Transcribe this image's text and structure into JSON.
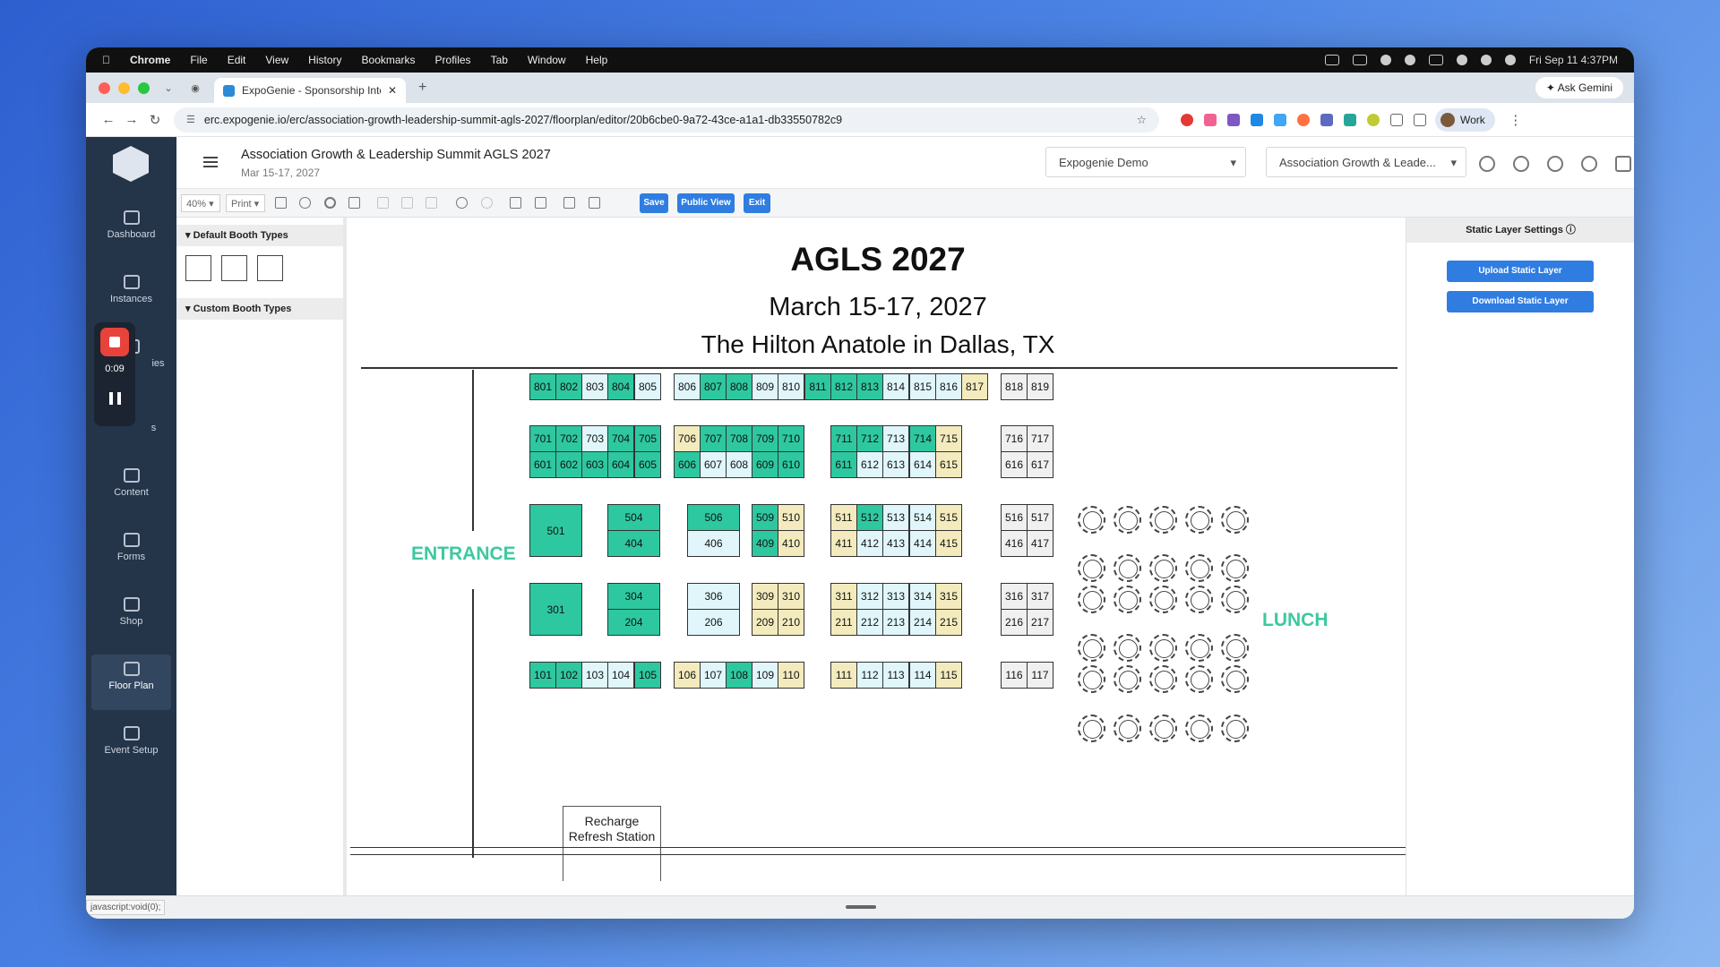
{
  "mac_menubar": {
    "app_name": "Chrome",
    "menus": [
      "File",
      "Edit",
      "View",
      "History",
      "Bookmarks",
      "Profiles",
      "Tab",
      "Window",
      "Help"
    ],
    "clock": "Fri Sep 11  4:37PM"
  },
  "browser": {
    "tab_title": "ExpoGenie - Sponsorship Inte",
    "gemini_label": "Ask Gemini",
    "url": "erc.expogenie.io/erc/association-growth-leadership-summit-agls-2027/floorplan/editor/20b6cbe0-9a72-43ce-a1a1-db33550782c9",
    "profile_label": "Work",
    "colors": {
      "close": "#ff5f57",
      "minimize": "#febc2e",
      "zoom": "#28c840"
    }
  },
  "sidebar": {
    "items": [
      {
        "label": "Dashboard",
        "icon": "home-icon"
      },
      {
        "label": "Instances",
        "icon": "building-icon"
      },
      {
        "label": "ies",
        "icon": "users-icon"
      },
      {
        "label": "s",
        "icon": "list-icon"
      },
      {
        "label": "Content",
        "icon": "content-icon"
      },
      {
        "label": "Forms",
        "icon": "forms-icon"
      },
      {
        "label": "Shop",
        "icon": "cart-icon"
      },
      {
        "label": "Floor Plan",
        "icon": "map-icon",
        "active": true
      },
      {
        "label": "Event Setup",
        "icon": "calendar-icon"
      }
    ],
    "recording_time": "0:09"
  },
  "header": {
    "event_title": "Association Growth & Leadership Summit AGLS 2027",
    "event_dates": "Mar 15-17, 2027",
    "org_select": "Expogenie Demo",
    "event_select": "Association Growth & Leade..."
  },
  "toolbar": {
    "zoom": "40%",
    "print": "Print",
    "save": "Save",
    "public_view": "Public View",
    "exit": "Exit"
  },
  "left_panel": {
    "default_types": "Default Booth Types",
    "custom_types": "Custom Booth Types"
  },
  "right_panel": {
    "title": "Static Layer Settings ⓘ",
    "upload": "Upload Static Layer",
    "download": "Download Static Layer"
  },
  "floorplan": {
    "title": "AGLS 2027",
    "dates": "March 15-17, 2027",
    "venue": "The Hilton Anatole in Dallas, TX",
    "entrance": "ENTRANCE",
    "lunch": "LUNCH",
    "recharge": "Recharge Refresh Station",
    "colors": {
      "teal": "#2ec8a0",
      "light": "#e0f6fb",
      "yellow": "#f3ebbd",
      "white": "#ffffff",
      "grey": "#f0f0f0"
    },
    "booths": [
      {
        "id": "801",
        "c": "teal"
      },
      {
        "id": "802",
        "c": "teal"
      },
      {
        "id": "803",
        "c": "light"
      },
      {
        "id": "804",
        "c": "teal"
      },
      {
        "id": "805",
        "c": "light"
      },
      {
        "id": "806",
        "c": "light"
      },
      {
        "id": "807",
        "c": "teal"
      },
      {
        "id": "808",
        "c": "teal"
      },
      {
        "id": "809",
        "c": "light"
      },
      {
        "id": "810",
        "c": "light"
      },
      {
        "id": "811",
        "c": "teal"
      },
      {
        "id": "812",
        "c": "teal"
      },
      {
        "id": "813",
        "c": "teal"
      },
      {
        "id": "814",
        "c": "light"
      },
      {
        "id": "815",
        "c": "light"
      },
      {
        "id": "816",
        "c": "light"
      },
      {
        "id": "817",
        "c": "yellow"
      },
      {
        "id": "818",
        "c": "grey"
      },
      {
        "id": "819",
        "c": "grey"
      },
      {
        "id": "701",
        "c": "teal"
      },
      {
        "id": "702",
        "c": "teal"
      },
      {
        "id": "703",
        "c": "light"
      },
      {
        "id": "704",
        "c": "teal"
      },
      {
        "id": "705",
        "c": "teal"
      },
      {
        "id": "706",
        "c": "yellow"
      },
      {
        "id": "707",
        "c": "teal"
      },
      {
        "id": "708",
        "c": "teal"
      },
      {
        "id": "709",
        "c": "teal"
      },
      {
        "id": "710",
        "c": "teal"
      },
      {
        "id": "711",
        "c": "teal"
      },
      {
        "id": "712",
        "c": "teal"
      },
      {
        "id": "713",
        "c": "light"
      },
      {
        "id": "714",
        "c": "teal"
      },
      {
        "id": "715",
        "c": "yellow"
      },
      {
        "id": "716",
        "c": "grey"
      },
      {
        "id": "717",
        "c": "grey"
      },
      {
        "id": "601",
        "c": "teal"
      },
      {
        "id": "602",
        "c": "teal"
      },
      {
        "id": "603",
        "c": "teal"
      },
      {
        "id": "604",
        "c": "teal"
      },
      {
        "id": "605",
        "c": "teal"
      },
      {
        "id": "606",
        "c": "teal"
      },
      {
        "id": "607",
        "c": "light"
      },
      {
        "id": "608",
        "c": "light"
      },
      {
        "id": "609",
        "c": "teal"
      },
      {
        "id": "610",
        "c": "teal"
      },
      {
        "id": "611",
        "c": "teal"
      },
      {
        "id": "612",
        "c": "light"
      },
      {
        "id": "613",
        "c": "light"
      },
      {
        "id": "614",
        "c": "light"
      },
      {
        "id": "615",
        "c": "yellow"
      },
      {
        "id": "616",
        "c": "grey"
      },
      {
        "id": "617",
        "c": "grey"
      },
      {
        "id": "501",
        "c": "teal"
      },
      {
        "id": "504",
        "c": "teal"
      },
      {
        "id": "506",
        "c": "teal"
      },
      {
        "id": "509",
        "c": "teal"
      },
      {
        "id": "510",
        "c": "yellow"
      },
      {
        "id": "511",
        "c": "yellow"
      },
      {
        "id": "512",
        "c": "teal"
      },
      {
        "id": "513",
        "c": "light"
      },
      {
        "id": "514",
        "c": "light"
      },
      {
        "id": "515",
        "c": "yellow"
      },
      {
        "id": "516",
        "c": "grey"
      },
      {
        "id": "517",
        "c": "grey"
      },
      {
        "id": "404",
        "c": "teal"
      },
      {
        "id": "406",
        "c": "light"
      },
      {
        "id": "409",
        "c": "teal"
      },
      {
        "id": "410",
        "c": "yellow"
      },
      {
        "id": "411",
        "c": "yellow"
      },
      {
        "id": "412",
        "c": "light"
      },
      {
        "id": "413",
        "c": "light"
      },
      {
        "id": "414",
        "c": "light"
      },
      {
        "id": "415",
        "c": "yellow"
      },
      {
        "id": "416",
        "c": "grey"
      },
      {
        "id": "417",
        "c": "grey"
      },
      {
        "id": "301",
        "c": "teal"
      },
      {
        "id": "304",
        "c": "teal"
      },
      {
        "id": "306",
        "c": "light"
      },
      {
        "id": "309",
        "c": "yellow"
      },
      {
        "id": "310",
        "c": "yellow"
      },
      {
        "id": "311",
        "c": "yellow"
      },
      {
        "id": "312",
        "c": "light"
      },
      {
        "id": "313",
        "c": "light"
      },
      {
        "id": "314",
        "c": "light"
      },
      {
        "id": "315",
        "c": "yellow"
      },
      {
        "id": "316",
        "c": "grey"
      },
      {
        "id": "317",
        "c": "grey"
      },
      {
        "id": "204",
        "c": "teal"
      },
      {
        "id": "206",
        "c": "light"
      },
      {
        "id": "209",
        "c": "yellow"
      },
      {
        "id": "210",
        "c": "yellow"
      },
      {
        "id": "211",
        "c": "yellow"
      },
      {
        "id": "212",
        "c": "light"
      },
      {
        "id": "213",
        "c": "light"
      },
      {
        "id": "214",
        "c": "light"
      },
      {
        "id": "215",
        "c": "yellow"
      },
      {
        "id": "216",
        "c": "grey"
      },
      {
        "id": "217",
        "c": "grey"
      },
      {
        "id": "101",
        "c": "teal"
      },
      {
        "id": "102",
        "c": "teal"
      },
      {
        "id": "103",
        "c": "light"
      },
      {
        "id": "104",
        "c": "light"
      },
      {
        "id": "105",
        "c": "teal"
      },
      {
        "id": "106",
        "c": "yellow"
      },
      {
        "id": "107",
        "c": "light"
      },
      {
        "id": "108",
        "c": "teal"
      },
      {
        "id": "109",
        "c": "light"
      },
      {
        "id": "110",
        "c": "yellow"
      },
      {
        "id": "111",
        "c": "yellow"
      },
      {
        "id": "112",
        "c": "light"
      },
      {
        "id": "113",
        "c": "light"
      },
      {
        "id": "114",
        "c": "light"
      },
      {
        "id": "115",
        "c": "yellow"
      },
      {
        "id": "116",
        "c": "grey"
      },
      {
        "id": "117",
        "c": "grey"
      }
    ]
  },
  "status": {
    "text": "javascript:void(0);"
  }
}
